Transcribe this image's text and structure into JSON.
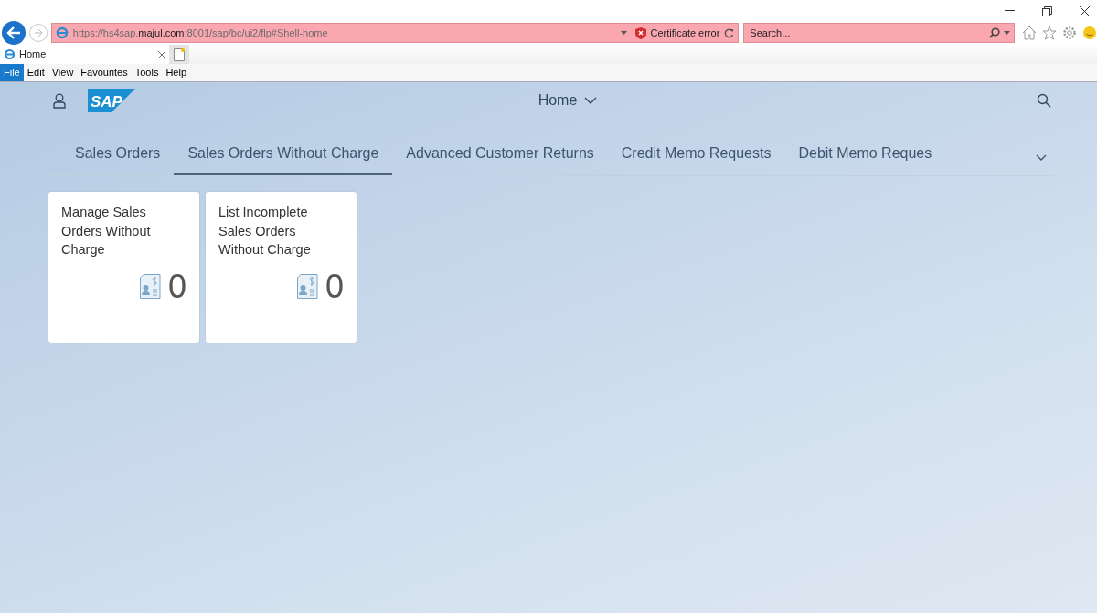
{
  "browser": {
    "address": "https://hs4sap.**majul.com**:8001/sap/bc/ui2/flp#Shell-home",
    "certificate": "Certificate error",
    "search": {
      "placeholder": "Search..."
    },
    "tabs": [
      {
        "label": "Home",
        "selected": true
      }
    ],
    "menu": [
      {
        "label": "File",
        "selected": true
      },
      {
        "label": "Edit",
        "selected": false
      },
      {
        "label": "View",
        "selected": false
      },
      {
        "label": "Favourites",
        "selected": false
      },
      {
        "label": "Tools",
        "selected": false
      },
      {
        "label": "Help",
        "selected": false
      }
    ]
  },
  "shell": {
    "logo": "SAP",
    "title": "Home"
  },
  "groups": [
    {
      "label": "Sales Orders",
      "selected": false
    },
    {
      "label": "Sales Orders Without Charge",
      "selected": true
    },
    {
      "label": "Advanced Customer Returns",
      "selected": false
    },
    {
      "label": "Credit Memo Requests",
      "selected": false
    },
    {
      "label": "Debit Memo Reques",
      "selected": false
    }
  ],
  "tiles": [
    {
      "title": "Manage Sales Orders Without Charge",
      "count": "0"
    },
    {
      "title": "List Incomplete Sales Orders Without Charge",
      "count": "0"
    }
  ]
}
